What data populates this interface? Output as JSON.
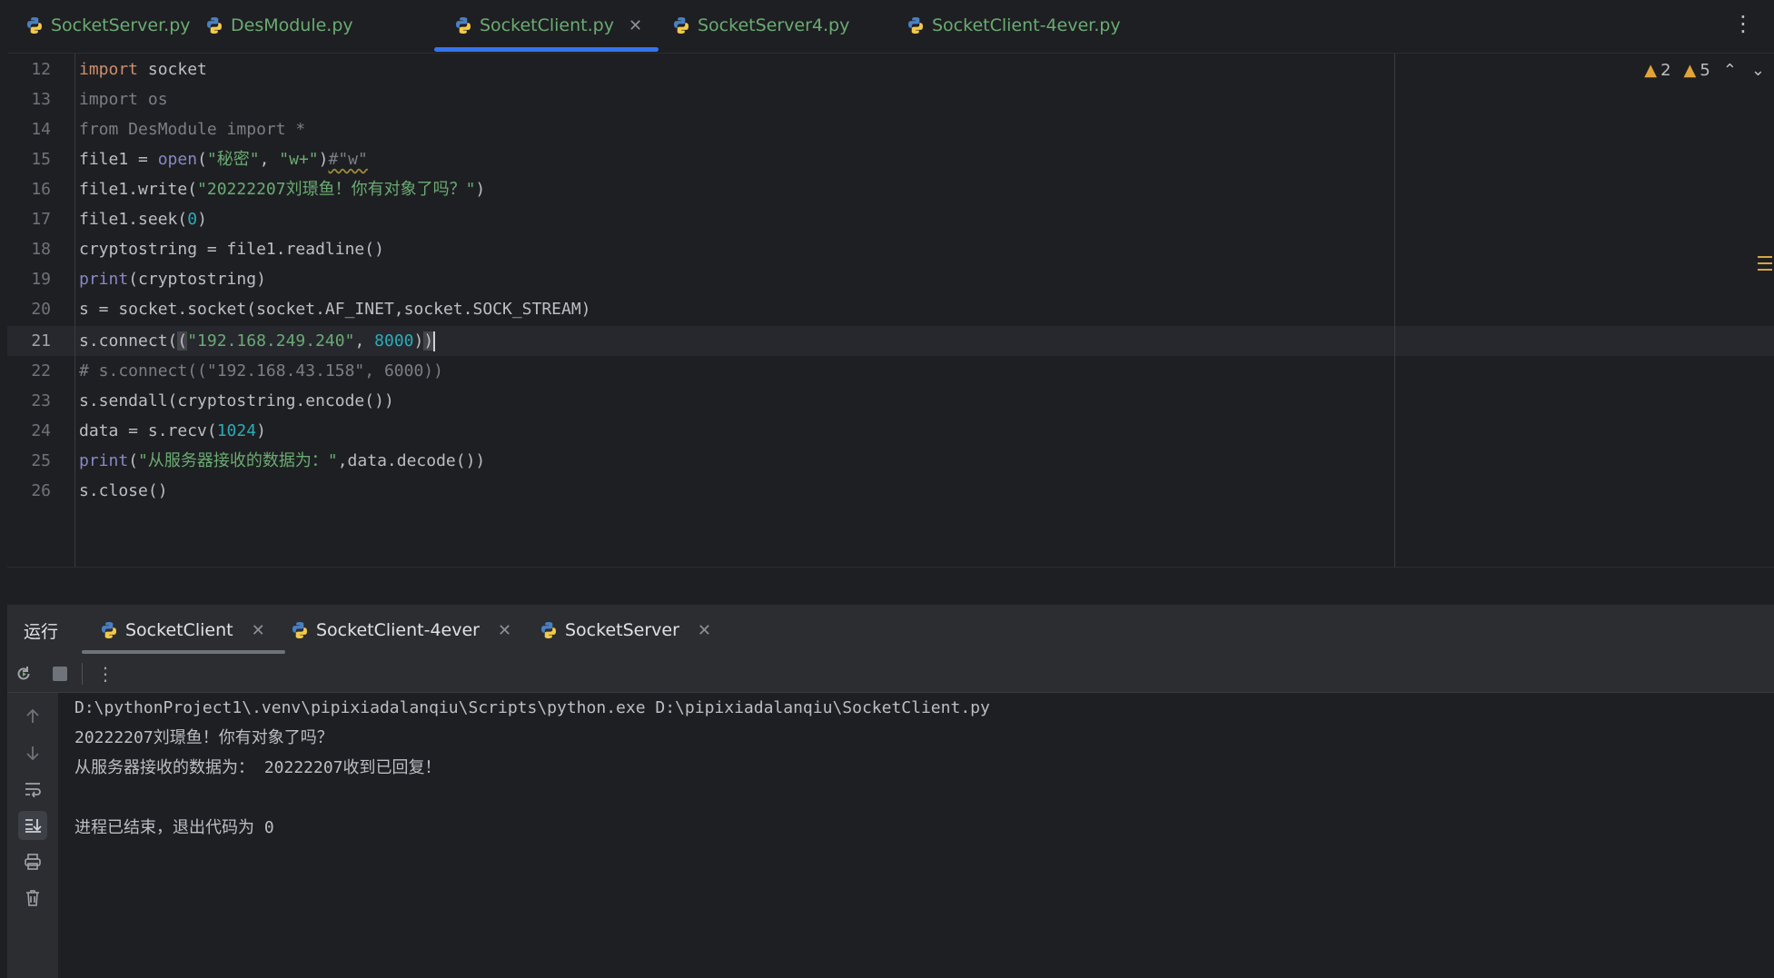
{
  "editor_tabs": [
    {
      "label": "SocketServer.py",
      "active": false
    },
    {
      "label": "DesModule.py",
      "active": false
    },
    {
      "label": "SocketClient.py",
      "active": true,
      "close": "✕"
    },
    {
      "label": "SocketServer4.py",
      "active": false
    },
    {
      "label": "SocketClient-4ever.py",
      "active": false
    }
  ],
  "more_icon": "⋮",
  "inspections": {
    "warnings_a": "2",
    "warnings_b": "5"
  },
  "line_numbers": [
    "12",
    "13",
    "14",
    "15",
    "16",
    "17",
    "18",
    "19",
    "20",
    "21",
    "22",
    "23",
    "24",
    "25",
    "26"
  ],
  "current_line": "21",
  "code": {
    "l12": {
      "kw": "import",
      "rest": " socket"
    },
    "l13": "import os",
    "l14": "from DesModule import *",
    "l15": {
      "a": "file1 = ",
      "fn": "open",
      "b": "(",
      "s1": "\"秘密\"",
      "c": ", ",
      "s2": "\"w+\"",
      "d": ")",
      "cmt": "#\"w\""
    },
    "l16": {
      "a": "file1.write(",
      "s": "\"20222207刘璟鱼！你有对象了吗？\"",
      "b": ")"
    },
    "l17": {
      "a": "file1.seek(",
      "n": "0",
      "b": ")"
    },
    "l18": "cryptostring = file1.readline()",
    "l19": {
      "fn": "print",
      "rest": "(cryptostring)"
    },
    "l20": "s = socket.socket(socket.AF_INET,socket.SOCK_STREAM)",
    "l21": {
      "a": "s.connect(",
      "p": "(",
      "s": "\"192.168.249.240\"",
      "c": ", ",
      "n": "8000",
      "b": ")",
      "pe": ")"
    },
    "l22": "# s.connect((\"192.168.43.158\", 6000))",
    "l23": "s.sendall(cryptostring.encode())",
    "l24": {
      "a": "data = s.recv(",
      "n": "1024",
      "b": ")"
    },
    "l25": {
      "fn": "print",
      "a": "(",
      "s": "\"从服务器接收的数据为：\"",
      "b": ",data.decode())"
    },
    "l26": "s.close()"
  },
  "run_panel": {
    "title": "运行",
    "tabs": [
      {
        "label": "SocketClient",
        "active": true
      },
      {
        "label": "SocketClient-4ever",
        "active": false
      },
      {
        "label": "SocketServer",
        "active": false
      }
    ],
    "close": "✕"
  },
  "console_lines": [
    "D:\\pythonProject1\\.venv\\pipixiadalanqiu\\Scripts\\python.exe D:\\pipixiadalanqiu\\SocketClient.py",
    "20222207刘璟鱼！你有对象了吗？",
    "从服务器接收的数据为： 20222207收到已回复！",
    "",
    "进程已结束，退出代码为 0"
  ],
  "icons": {
    "rerun": "rerun-icon",
    "stop": "stop-icon",
    "up": "arrow-up-icon",
    "down": "arrow-down-icon",
    "wrap": "soft-wrap-icon",
    "scroll_end": "scroll-to-end-icon",
    "print": "print-icon",
    "trash": "trash-icon"
  }
}
